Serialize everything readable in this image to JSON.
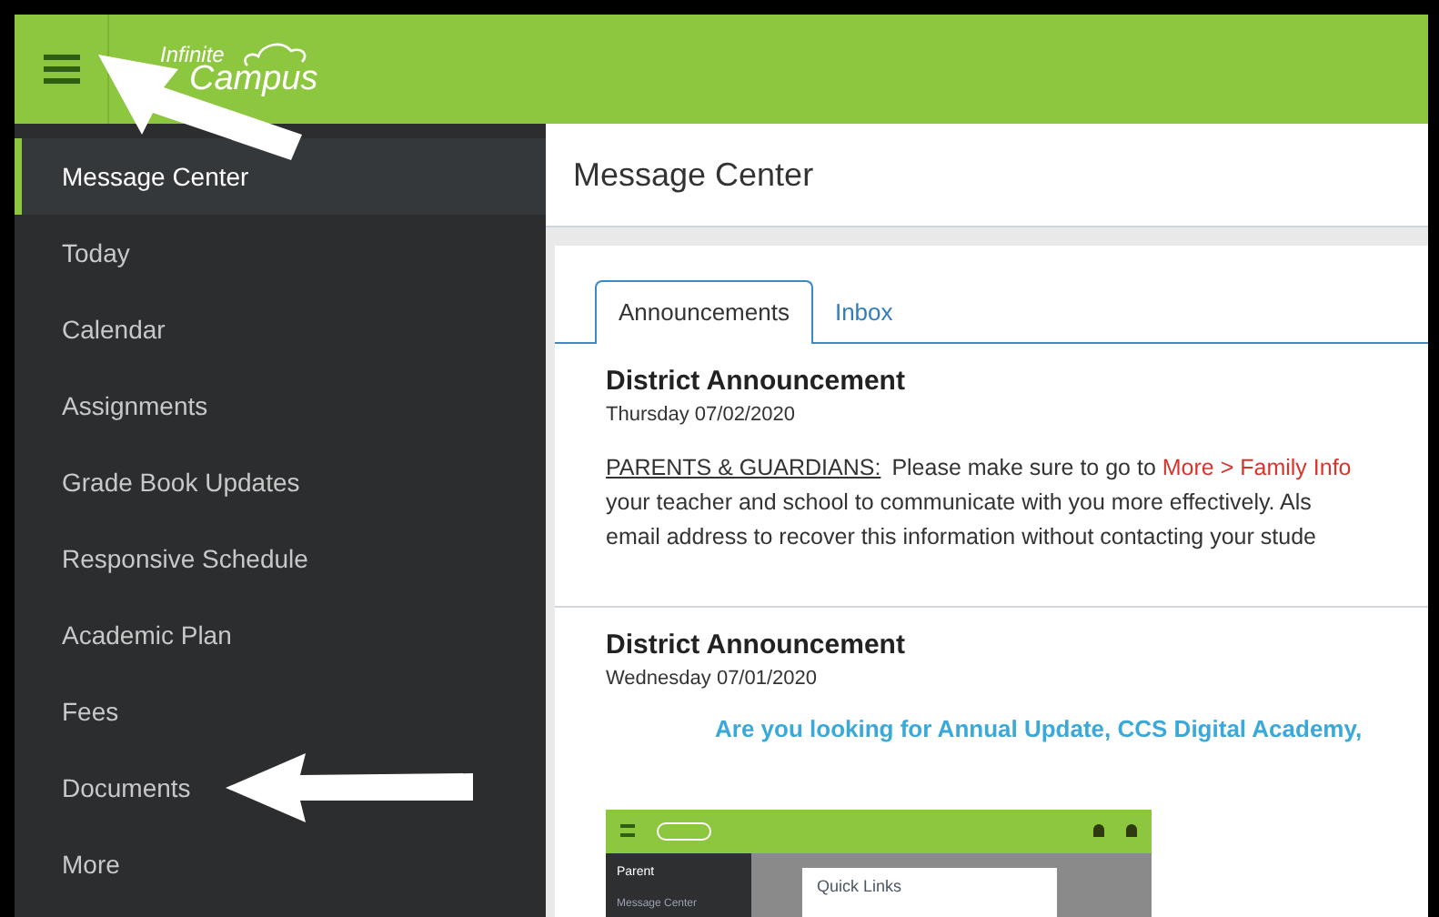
{
  "header": {
    "logo": {
      "line_1": "Infinite",
      "line_2": "Campus"
    }
  },
  "sidebar": {
    "items": [
      {
        "label": "Message Center",
        "selected": true
      },
      {
        "label": "Today",
        "selected": false
      },
      {
        "label": "Calendar",
        "selected": false
      },
      {
        "label": "Assignments",
        "selected": false
      },
      {
        "label": "Grade Book Updates",
        "selected": false
      },
      {
        "label": "Responsive Schedule",
        "selected": false
      },
      {
        "label": "Academic Plan",
        "selected": false
      },
      {
        "label": "Fees",
        "selected": false
      },
      {
        "label": "Documents",
        "selected": false
      },
      {
        "label": "More",
        "selected": false
      }
    ]
  },
  "page_title": "Message Center",
  "tabs": [
    {
      "label": "Announcements",
      "selected": true
    },
    {
      "label": "Inbox",
      "selected": false
    }
  ],
  "announcements": [
    {
      "title": "District Announcement",
      "date": "Thursday 07/02/2020",
      "kind": "text",
      "lines": [
        "PARENTS & GUARDIANS:",
        "Please make sure to go to ",
        "More > Family Info",
        "your teacher and school to communicate with you more effectively.  Als",
        "email address to recover this information without contacting your stude"
      ]
    },
    {
      "title": "District Announcement",
      "date": "Wednesday 07/01/2020",
      "kind": "image",
      "headline": "Are you looking for Annual Update, CCS Digital Academy,",
      "screenshot": {
        "menu_label": "Parent",
        "sidebar_item": "Message Center",
        "panel_title": "Quick Links"
      }
    }
  ]
}
